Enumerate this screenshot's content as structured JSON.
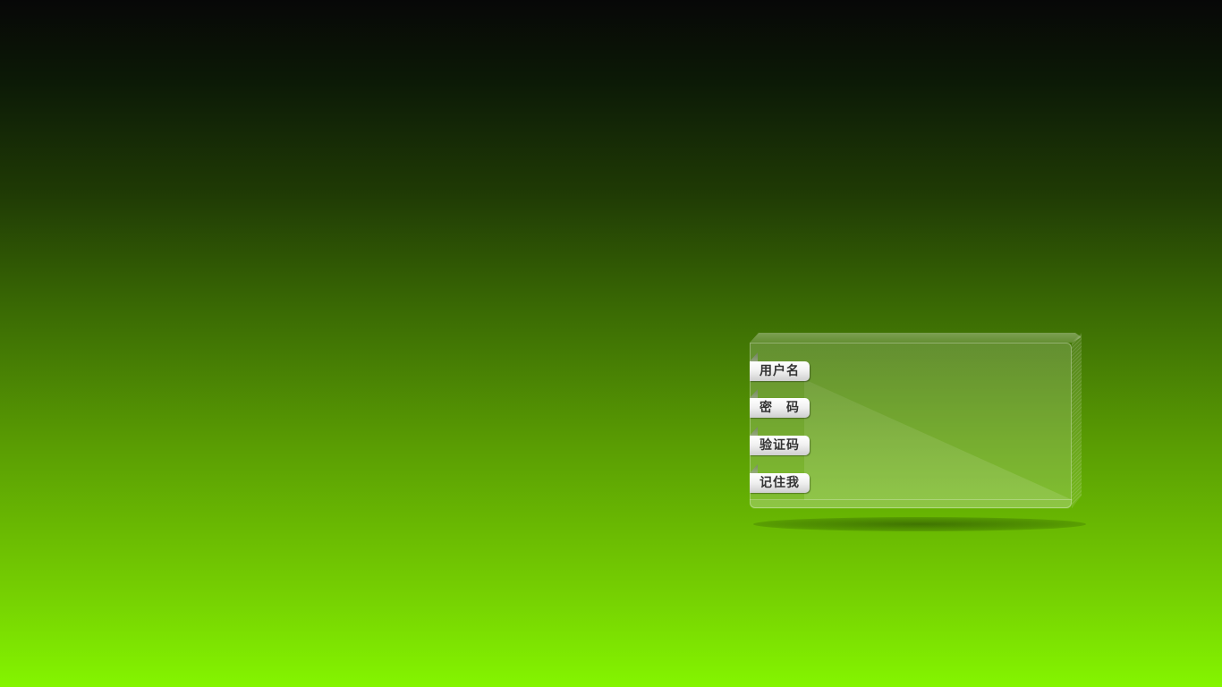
{
  "login_panel": {
    "fields": [
      {
        "label": "用户名"
      },
      {
        "label": "密　码"
      },
      {
        "label": "验证码"
      },
      {
        "label": "记住我"
      }
    ]
  },
  "colors": {
    "background_top": "#070707",
    "background_bottom": "#84f500",
    "label_text": "#333333"
  }
}
